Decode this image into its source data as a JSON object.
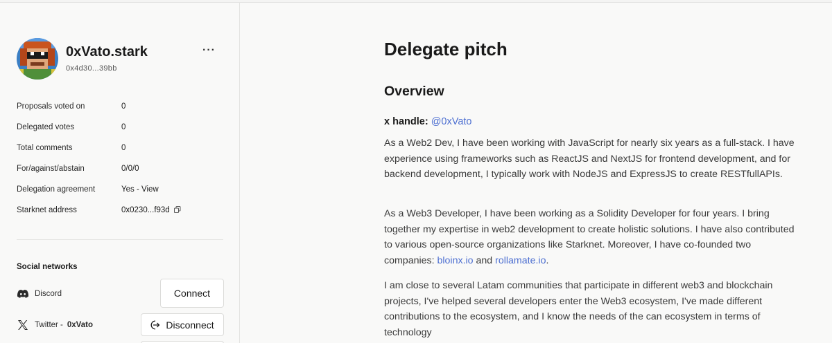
{
  "profile": {
    "name": "0xVato.stark",
    "address": "0x4d30...39bb",
    "more_label": "···"
  },
  "stats": [
    {
      "label": "Proposals voted on",
      "value": "0"
    },
    {
      "label": "Delegated votes",
      "value": "0"
    },
    {
      "label": "Total comments",
      "value": "0"
    },
    {
      "label": "For/against/abstain",
      "value": "0/0/0"
    },
    {
      "label": "Delegation agreement",
      "value": "Yes - ",
      "link": "View"
    },
    {
      "label": "Starknet address",
      "value": "0x0230...f93d"
    }
  ],
  "social": {
    "title": "Social networks",
    "discord": {
      "label": "Discord",
      "button": "Connect"
    },
    "twitter": {
      "label": "Twitter - ",
      "handle": "0xVato",
      "button": "Disconnect"
    }
  },
  "pitch": {
    "title": "Delegate pitch",
    "section": "Overview",
    "x_handle_label": "x handle:",
    "x_handle_value": "@0xVato",
    "p1": "As a Web2 Dev, I have been working with JavaScript for nearly six years as a full-stack. I have experience using frameworks such as ReactJS and NextJS for frontend development, and for backend development, I typically work with NodeJS and ExpressJS to create RESTfullAPIs.",
    "p2_text": "As a Web3 Developer, I have been working as a Solidity Developer for four years. I bring together my expertise in web2 development to create holistic solutions. I have also contributed to various open-source organizations like Starknet. Moreover, I have co-founded two companies: ",
    "p2_link1": "bloinx.io",
    "p2_and": " and ",
    "p2_link2": "rollamate.io",
    "p2_end": ".",
    "p3": "I am close to several Latam communities that participate in different web3 and blockchain projects, I've helped several developers enter the Web3 ecosystem, I've made different contributions to the ecosystem, and I know the needs of the can ecosystem in terms of technology"
  },
  "colors": {
    "link": "#4d6fd1",
    "border": "#e4e4e2",
    "background": "#f9f9f8"
  }
}
